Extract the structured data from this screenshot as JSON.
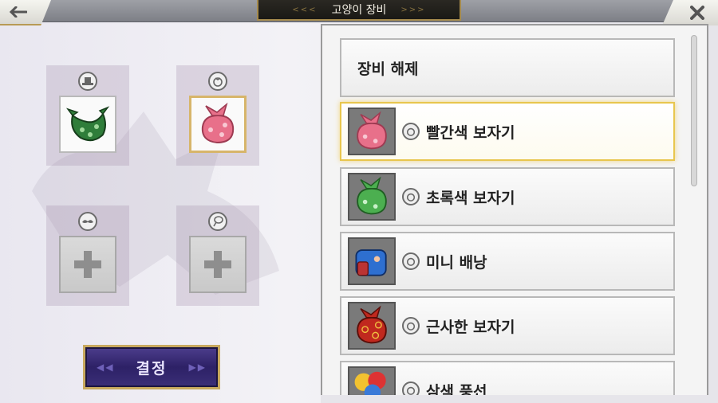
{
  "header": {
    "title": "고양이 장비",
    "back_icon": "arrow-left-icon",
    "close_icon": "close-icon"
  },
  "slots": [
    {
      "name": "hat",
      "icon": "hat-icon",
      "item": "green-bandana",
      "state": "filled"
    },
    {
      "name": "back",
      "icon": "bundle-icon",
      "item": "red-bundle",
      "state": "selected"
    },
    {
      "name": "face",
      "icon": "mustache-icon",
      "item": "",
      "state": "empty"
    },
    {
      "name": "accessory",
      "icon": "balloon-icon",
      "item": "",
      "state": "empty"
    }
  ],
  "confirm_label": "결정",
  "list": {
    "unequip_label": "장비 해제",
    "items": [
      {
        "label": "빨간색 보자기",
        "color": "#e8708a",
        "selected": true
      },
      {
        "label": "초록색 보자기",
        "color": "#4caf50",
        "selected": false
      },
      {
        "label": "미니 배낭",
        "color": "#2e6fd0",
        "selected": false
      },
      {
        "label": "근사한 보자기",
        "color": "#c0281e",
        "selected": false
      },
      {
        "label": "삼색 풍선",
        "color": "#d33",
        "selected": false
      }
    ]
  },
  "colors": {
    "accent_gold": "#d7b56a",
    "confirm_purple": "#2d2166"
  }
}
